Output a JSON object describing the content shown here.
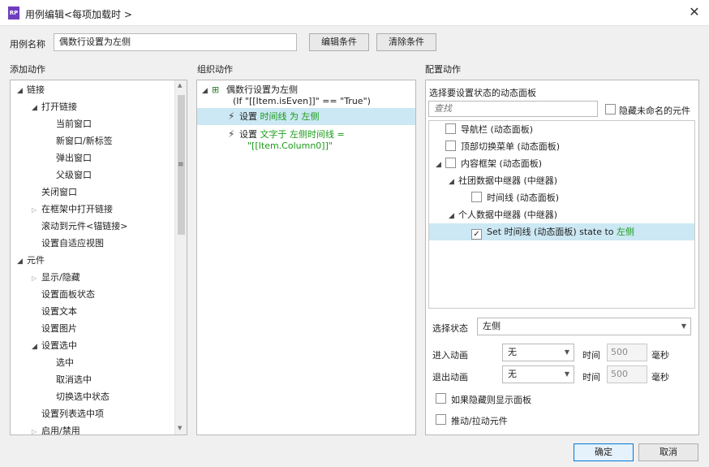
{
  "window": {
    "title": "用例编辑<每项加载时 >",
    "app_icon_text": "RP"
  },
  "case_name": {
    "label": "用例名称",
    "value": "偶数行设置为左侧"
  },
  "buttons": {
    "edit_condition": "编辑条件",
    "clear_condition": "清除条件",
    "ok": "确定",
    "cancel": "取消"
  },
  "add_action": {
    "title": "添加动作",
    "items": [
      {
        "label": "链接",
        "level": 0,
        "toggle": "open"
      },
      {
        "label": "打开链接",
        "level": 1,
        "toggle": "open"
      },
      {
        "label": "当前窗口",
        "level": 2,
        "toggle": "none"
      },
      {
        "label": "新窗口/新标签",
        "level": 2,
        "toggle": "none"
      },
      {
        "label": "弹出窗口",
        "level": 2,
        "toggle": "none"
      },
      {
        "label": "父级窗口",
        "level": 2,
        "toggle": "none"
      },
      {
        "label": "关闭窗口",
        "level": 1,
        "toggle": "none"
      },
      {
        "label": "在框架中打开链接",
        "level": 1,
        "toggle": "closed"
      },
      {
        "label": "滚动到元件<锚链接>",
        "level": 1,
        "toggle": "none"
      },
      {
        "label": "设置自适应视图",
        "level": 1,
        "toggle": "none"
      },
      {
        "label": "元件",
        "level": 0,
        "toggle": "open"
      },
      {
        "label": "显示/隐藏",
        "level": 1,
        "toggle": "closed"
      },
      {
        "label": "设置面板状态",
        "level": 1,
        "toggle": "none"
      },
      {
        "label": "设置文本",
        "level": 1,
        "toggle": "none"
      },
      {
        "label": "设置图片",
        "level": 1,
        "toggle": "none"
      },
      {
        "label": "设置选中",
        "level": 1,
        "toggle": "open"
      },
      {
        "label": "选中",
        "level": 2,
        "toggle": "none"
      },
      {
        "label": "取消选中",
        "level": 2,
        "toggle": "none"
      },
      {
        "label": "切换选中状态",
        "level": 2,
        "toggle": "none"
      },
      {
        "label": "设置列表选中项",
        "level": 1,
        "toggle": "none"
      },
      {
        "label": "启用/禁用",
        "level": 1,
        "toggle": "closed"
      }
    ]
  },
  "organize_action": {
    "title": "组织动作",
    "case_label": "偶数行设置为左侧",
    "condition": "(If \"[[Item.isEven]]\" == \"True\")",
    "actions": [
      {
        "prefix": "设置 ",
        "highlight": "时间线 为 左侧",
        "line2": ""
      },
      {
        "prefix": "设置 ",
        "highlight": "文字于 左侧时间线 =",
        "line2": "\"[[Item.Column0]]\""
      }
    ]
  },
  "config_action": {
    "title": "配置动作",
    "subtitle": "选择要设置状态的动态面板",
    "search_placeholder": "查找",
    "hide_unnamed": "隐藏未命名的元件",
    "panels": [
      {
        "label": "导航栏 (动态面板)",
        "level": 0,
        "toggle": "none",
        "checked": false
      },
      {
        "label": "顶部切换菜单 (动态面板)",
        "level": 0,
        "toggle": "none",
        "checked": false
      },
      {
        "label": "内容框架 (动态面板)",
        "level": 0,
        "toggle": "open",
        "checked": false
      },
      {
        "label": "社团数据中继器 (中继器)",
        "level": 1,
        "toggle": "open",
        "checked": null
      },
      {
        "label": "时间线 (动态面板)",
        "level": 2,
        "toggle": "none",
        "checked": false
      },
      {
        "label": "个人数据中继器 (中继器)",
        "level": 1,
        "toggle": "open",
        "checked": null
      },
      {
        "label": "Set 时间线 (动态面板) state to ",
        "highlight": "左侧",
        "level": 2,
        "toggle": "none",
        "checked": true
      }
    ],
    "select_state": {
      "label": "选择状态",
      "value": "左侧"
    },
    "enter_anim": {
      "label": "进入动画",
      "value": "无",
      "time_label": "时间",
      "time_value": "500",
      "unit": "毫秒"
    },
    "exit_anim": {
      "label": "退出动画",
      "value": "无",
      "time_label": "时间",
      "time_value": "500",
      "unit": "毫秒"
    },
    "show_if_hidden": "如果隐藏则显示面板",
    "push_pull": "推动/拉动元件"
  }
}
